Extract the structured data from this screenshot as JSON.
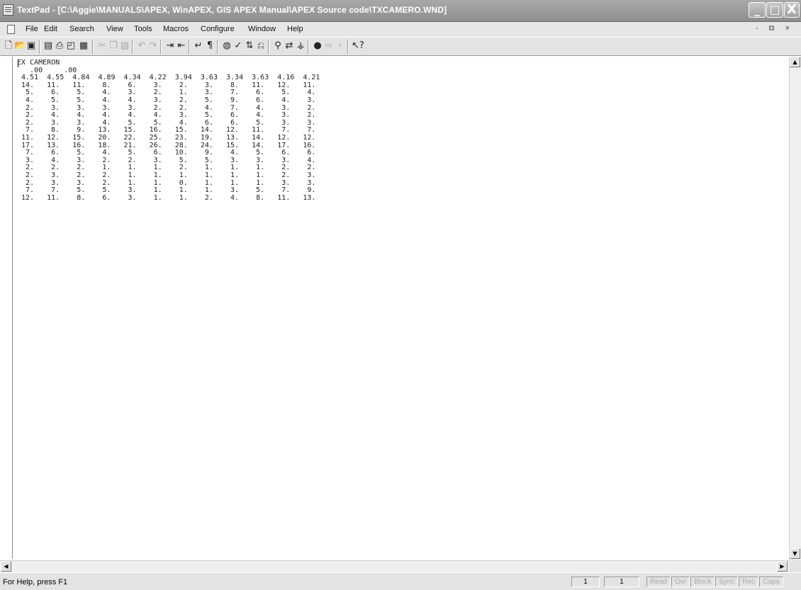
{
  "window": {
    "title": "TextPad - [C:\\Aggie\\MANUALS\\APEX, WinAPEX, GIS APEX Manual\\APEX Source code\\TXCAMERO.WND]",
    "minimize_label": "_",
    "maximize_label": "□",
    "close_label": "X"
  },
  "menu": {
    "items": [
      "File",
      "Edit",
      "Search",
      "View",
      "Tools",
      "Macros",
      "Configure",
      "Window",
      "Help"
    ],
    "mdi_controls": "- ⧉ ×"
  },
  "toolbar": {
    "icons": [
      "new-file-icon",
      "open-icon",
      "save-icon",
      "save-all-icon",
      "print-icon",
      "print-preview-icon",
      "manage-files-icon",
      "cut-icon",
      "copy-icon",
      "paste-icon",
      "undo-icon",
      "redo-icon",
      "indent-icon",
      "outdent-icon",
      "word-wrap-icon",
      "visible-spaces-icon",
      "spelling-icon",
      "spell-check-icon",
      "sort-icon",
      "compare-icon",
      "find-icon",
      "replace-icon",
      "find-in-files-icon",
      "bookmark-icon",
      "prev-bookmark-icon",
      "next-bookmark-icon",
      "context-help-icon"
    ]
  },
  "document": {
    "lines": [
      "EX CAMERON",
      "   .00     .00",
      " 4.51  4.55  4.84  4.89  4.34  4.22  3.94  3.63  3.34  3.63  4.16  4.21",
      " 14.   11.   11.    8.    6.    3.    2.    3.    8.   11.   12.   11.",
      "  5.    6.    5.    4.    3.    2.    1.    3.    7.    6.    5.    4.",
      "  4.    5.    5.    4.    4.    3.    2.    5.    9.    6.    4.    3.",
      "  2.    3.    3.    3.    3.    2.    2.    4.    7.    4.    3.    2.",
      "  2.    4.    4.    4.    4.    4.    3.    5.    6.    4.    3.    2.",
      "  2.    3.    3.    4.    5.    5.    4.    6.    6.    5.    3.    3.",
      "  7.    8.    9.   13.   15.   16.   15.   14.   12.   11.    7.    7.",
      " 11.   12.   15.   20.   22.   25.   23.   19.   13.   14.   12.   12.",
      " 17.   13.   16.   18.   21.   26.   28.   24.   15.   14.   17.   16.",
      "  7.    6.    5.    4.    5.    6.   10.    9.    4.    5.    6.    6.",
      "  3.    4.    3.    2.    2.    3.    5.    5.    3.    3.    3.    4.",
      "  2.    2.    2.    1.    1.    1.    2.    1.    1.    1.    2.    2.",
      "  2.    3.    2.    2.    1.    1.    1.    1.    1.    1.    2.    3.",
      "  2.    3.    3.    2.    1.    1.    0.    1.    1.    1.    3.    3.",
      "  7.    7.    5.    5.    3.    1.    1.    1.    3.    5.    7.    9.",
      " 12.   11.    8.    6.    3.    1.    1.    2.    4.    8.   11.   13."
    ]
  },
  "status": {
    "help_text": "For Help, press F1",
    "line": "1",
    "column": "1",
    "flags": [
      "Read",
      "Ovr",
      "Block",
      "Sync",
      "Rec",
      "Caps"
    ]
  }
}
